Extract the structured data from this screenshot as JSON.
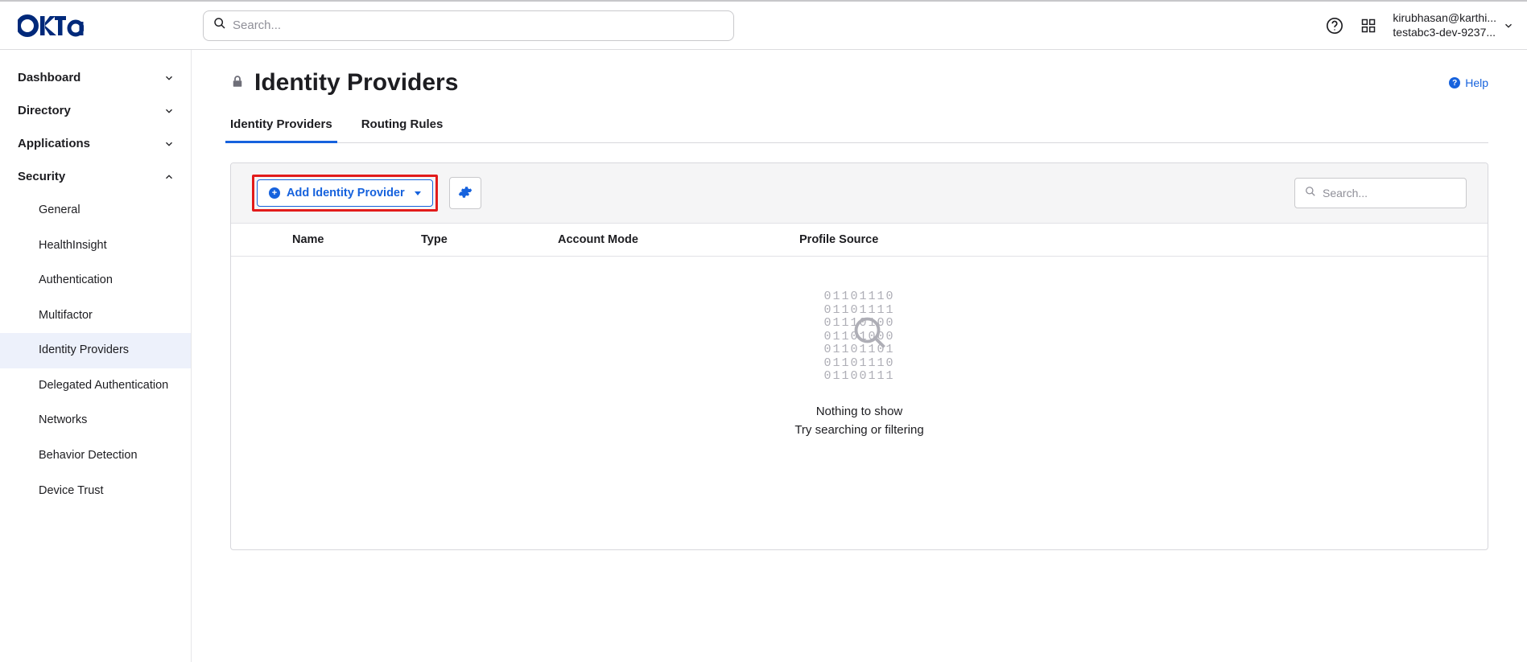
{
  "header": {
    "search_placeholder": "Search...",
    "user_email": "kirubhasan@karthi...",
    "user_org": "testabc3-dev-9237..."
  },
  "sidebar": {
    "sections": [
      {
        "label": "Dashboard",
        "expanded": false
      },
      {
        "label": "Directory",
        "expanded": false
      },
      {
        "label": "Applications",
        "expanded": false
      },
      {
        "label": "Security",
        "expanded": true
      }
    ],
    "security_items": [
      {
        "label": "General"
      },
      {
        "label": "HealthInsight"
      },
      {
        "label": "Authentication"
      },
      {
        "label": "Multifactor"
      },
      {
        "label": "Identity Providers",
        "active": true
      },
      {
        "label": "Delegated Authentication"
      },
      {
        "label": "Networks"
      },
      {
        "label": "Behavior Detection"
      },
      {
        "label": "Device Trust"
      }
    ]
  },
  "page": {
    "title": "Identity Providers",
    "help_label": "Help",
    "tabs": [
      {
        "label": "Identity Providers",
        "active": true
      },
      {
        "label": "Routing Rules",
        "active": false
      }
    ],
    "toolbar": {
      "add_label": "Add Identity Provider",
      "search_placeholder": "Search..."
    },
    "table": {
      "columns": {
        "name": "Name",
        "type": "Type",
        "account_mode": "Account Mode",
        "profile_source": "Profile Source"
      },
      "empty": {
        "binary_lines": [
          "01101110",
          "01101111",
          "01110100",
          "01101000",
          "01101101",
          "01101110",
          "01100111"
        ],
        "line1": "Nothing to show",
        "line2": "Try searching or filtering"
      }
    }
  }
}
